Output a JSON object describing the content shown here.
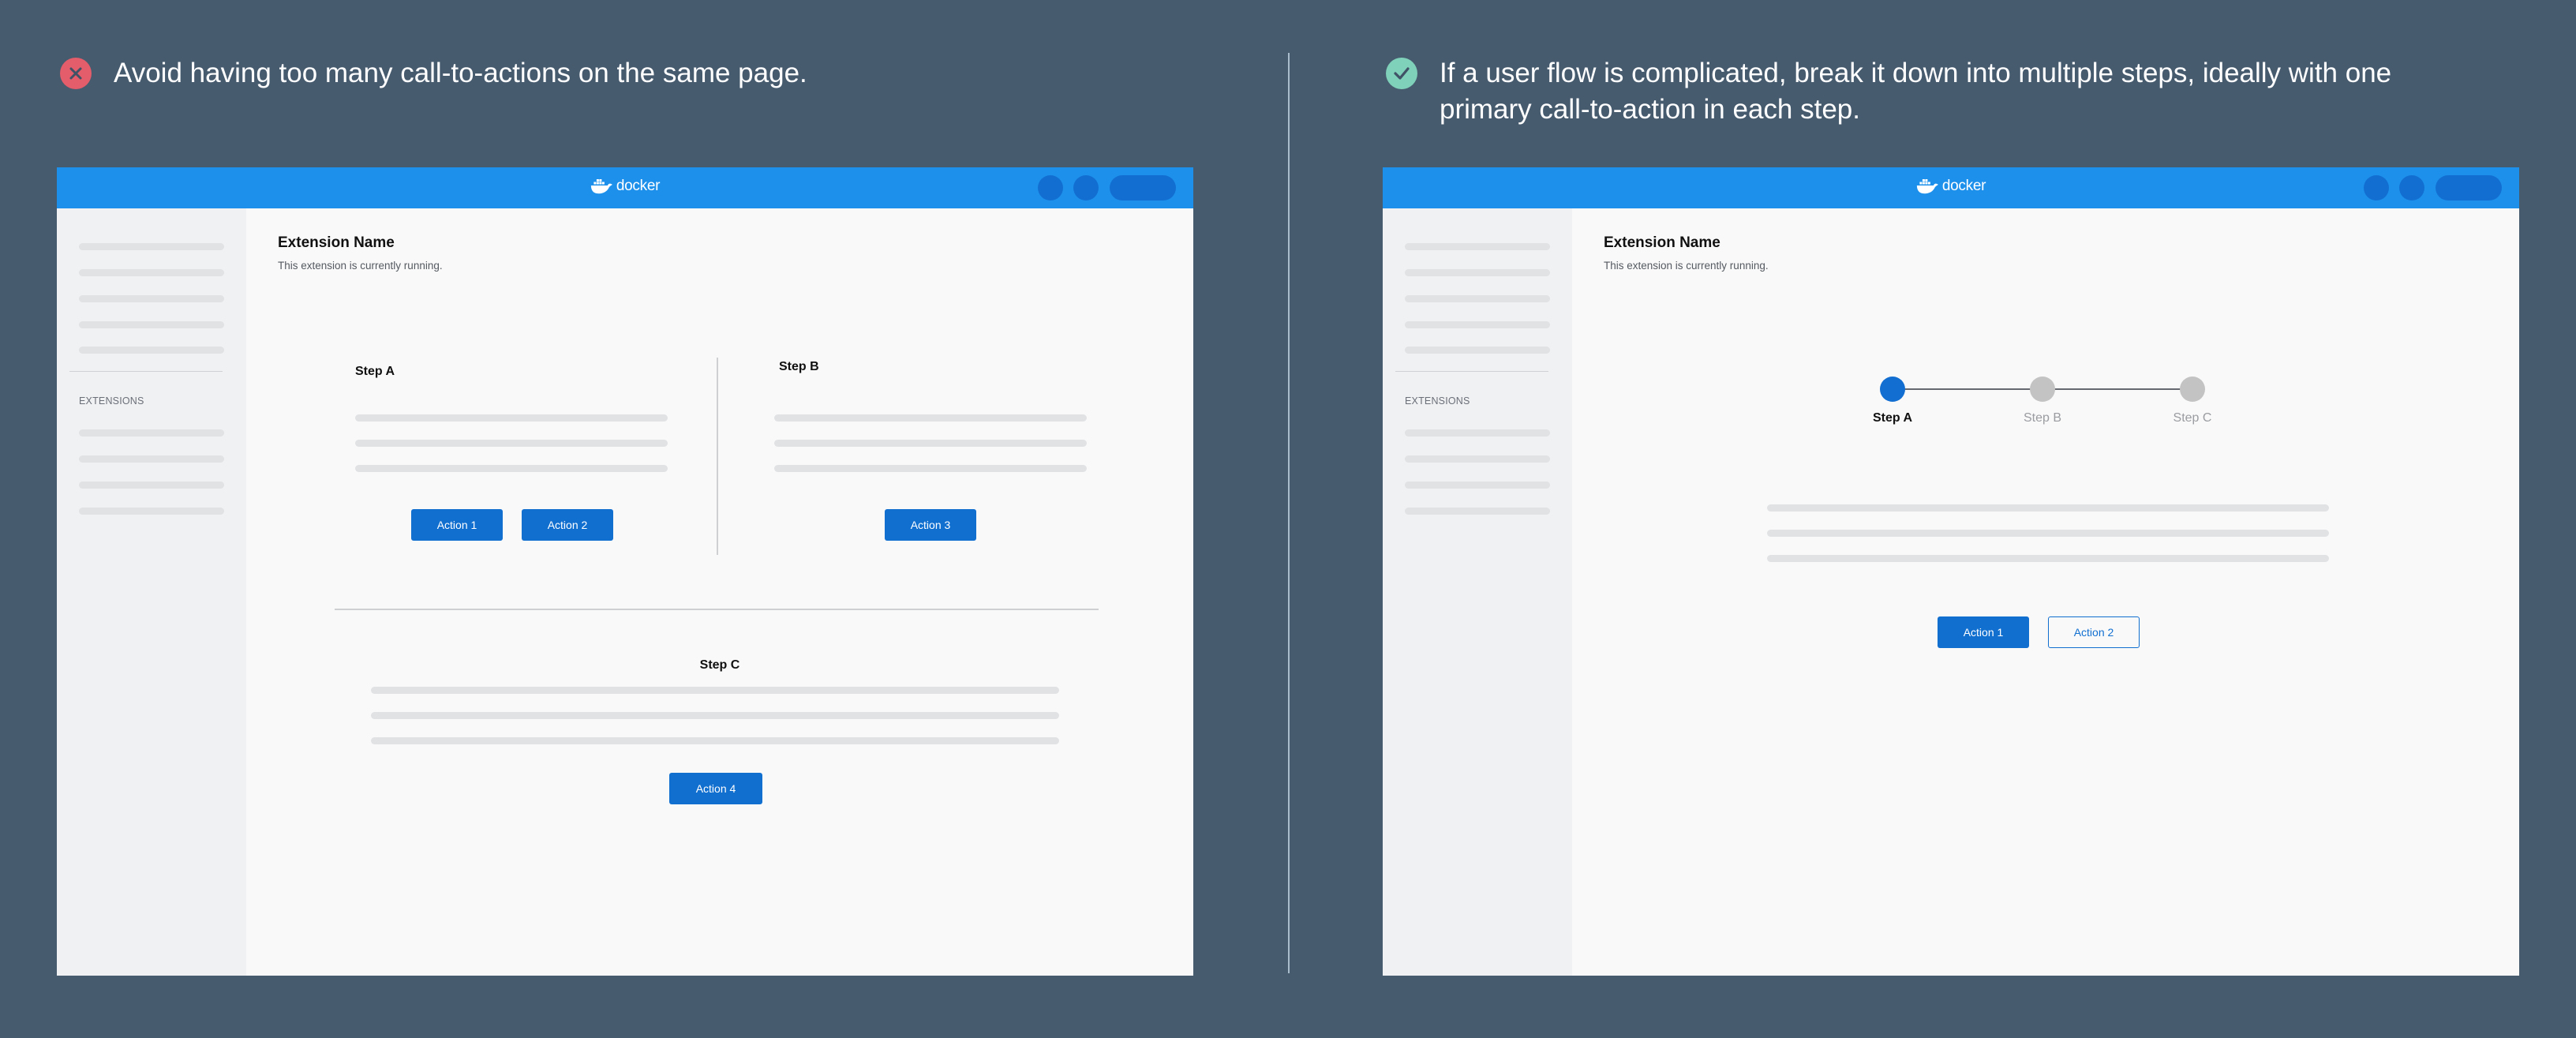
{
  "captions": {
    "bad": {
      "icon": "x-circle-icon",
      "color": "#e35d6a",
      "text": "Avoid having too many call-to-actions on the same page."
    },
    "good": {
      "icon": "check-circle-icon",
      "color": "#7fd1b9",
      "text": "If a user flow is complicated, break it down into multiple steps, ideally with one primary call-to-action in each step."
    }
  },
  "colors": {
    "background": "#475b6f",
    "topbar": "#1d90eb",
    "primary": "#116fd0",
    "sidebar": "#f0f1f3",
    "content": "#f9f9fa"
  },
  "app": {
    "logo_text": "docker",
    "sidebar_section": "EXTENSIONS",
    "extension_name": "Extension Name",
    "extension_status": "This extension is currently running."
  },
  "bad_example": {
    "step_a": {
      "title": "Step A",
      "actions": [
        "Action 1",
        "Action 2"
      ]
    },
    "step_b": {
      "title": "Step B",
      "actions": [
        "Action 3"
      ]
    },
    "step_c": {
      "title": "Step C",
      "actions": [
        "Action 4"
      ]
    }
  },
  "good_example": {
    "stepper": [
      {
        "label": "Step A",
        "state": "active"
      },
      {
        "label": "Step B",
        "state": "inactive"
      },
      {
        "label": "Step C",
        "state": "inactive"
      }
    ],
    "primary_action": "Action 1",
    "secondary_action": "Action 2"
  }
}
